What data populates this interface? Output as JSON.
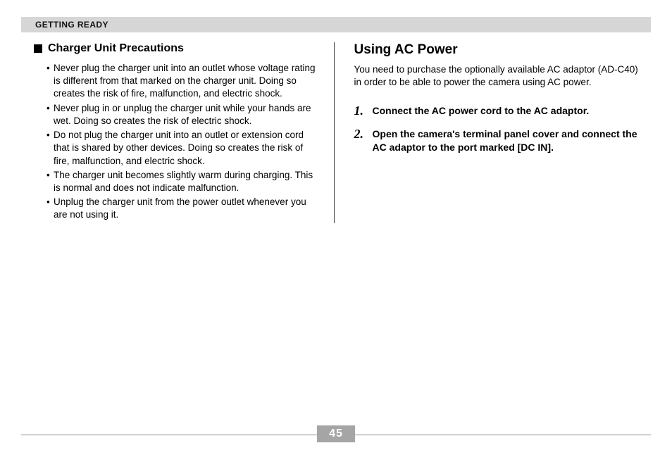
{
  "header": {
    "section": "GETTING READY"
  },
  "left": {
    "subheading": "Charger Unit Precautions",
    "bullets": [
      "Never plug the charger unit into an outlet whose voltage rating is different from that marked on the charger unit. Doing so creates the risk of fire, malfunction, and electric shock.",
      "Never plug in or unplug the charger unit while your hands are wet. Doing so creates the risk of electric shock.",
      "Do not plug the charger unit into an outlet or extension cord that is shared by other devices. Doing so creates the risk of fire, malfunction, and electric shock.",
      "The charger unit becomes slightly warm during charging. This is normal and does not indicate malfunction.",
      "Unplug the charger unit from the power outlet whenever you are not using it."
    ]
  },
  "right": {
    "title": "Using AC Power",
    "intro": "You need to purchase the optionally available AC adaptor (AD-C40) in order to be able to power the camera using AC power.",
    "steps": [
      {
        "num": "1.",
        "text": "Connect the AC power cord to the AC adaptor."
      },
      {
        "num": "2.",
        "text": "Open the camera's terminal panel cover and connect the AC adaptor to the port marked [DC IN]."
      }
    ]
  },
  "page_number": "45"
}
